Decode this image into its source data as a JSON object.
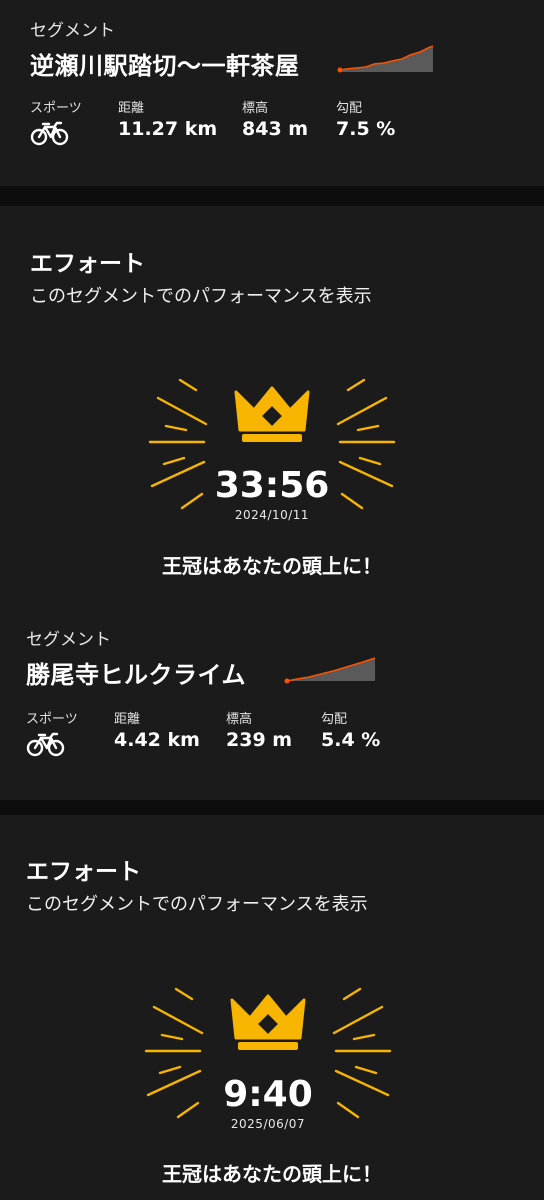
{
  "colors": {
    "background": "#0d0d0d",
    "card": "#1b1b1b",
    "accent_orange": "#fc5200",
    "crown_gold": "#f7b500",
    "chart_fill": "#5a5a5a"
  },
  "segment1": {
    "section_label": "セグメント",
    "title": "逆瀬川駅踏切〜一軒茶屋",
    "sport_label": "スポーツ",
    "sport_icon": "bike-icon",
    "distance_label": "距離",
    "distance_value": "11.27 km",
    "elevation_label": "標高",
    "elevation_value": "843 m",
    "grade_label": "勾配",
    "grade_value": "7.5 %"
  },
  "effort1": {
    "heading": "エフォート",
    "subtitle": "このセグメントでのパフォーマンスを表示",
    "time": "33:56",
    "date": "2024/10/11",
    "crown_message": "王冠はあなたの頭上に！",
    "crown_icon": "crown-icon"
  },
  "segment2": {
    "section_label": "セグメント",
    "title": "勝尾寺ヒルクライム",
    "sport_label": "スポーツ",
    "sport_icon": "bike-icon",
    "distance_label": "距離",
    "distance_value": "4.42 km",
    "elevation_label": "標高",
    "elevation_value": "239 m",
    "grade_label": "勾配",
    "grade_value": "5.4 %"
  },
  "effort2": {
    "heading": "エフォート",
    "subtitle": "このセグメントでのパフォーマンスを表示",
    "time": "9:40",
    "date": "2025/06/07",
    "crown_message": "王冠はあなたの頭上に！",
    "crown_icon": "crown-icon"
  }
}
